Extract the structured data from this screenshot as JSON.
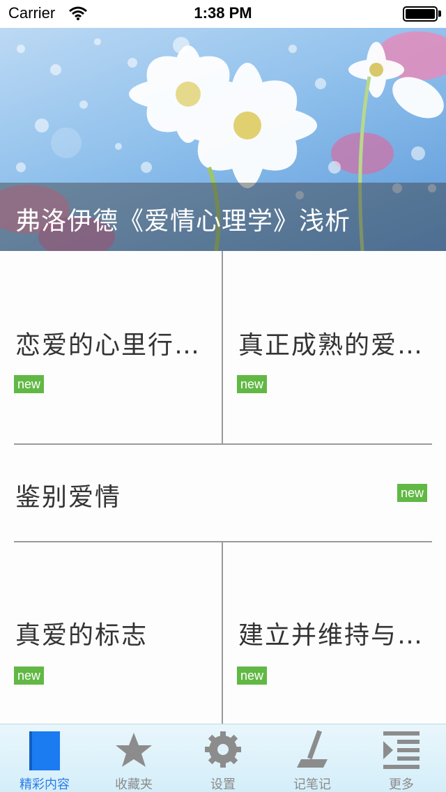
{
  "status_bar": {
    "carrier": "Carrier",
    "time": "1:38 PM"
  },
  "banner": {
    "title": "弗洛伊德《爱情心理学》浅析"
  },
  "articles": [
    {
      "title": "恋爱的心里行…",
      "badge": "new"
    },
    {
      "title": "真正成熟的爱…",
      "badge": "new"
    },
    {
      "title": "鉴别爱情",
      "badge": "new"
    },
    {
      "title": "真爱的标志",
      "badge": "new"
    },
    {
      "title": "建立并维持与…",
      "badge": "new"
    }
  ],
  "tabs": [
    {
      "label": "精彩内容",
      "icon": "book-icon",
      "active": true
    },
    {
      "label": "收藏夹",
      "icon": "star-icon",
      "active": false
    },
    {
      "label": "设置",
      "icon": "gear-icon",
      "active": false
    },
    {
      "label": "记笔记",
      "icon": "pen-icon",
      "active": false
    },
    {
      "label": "更多",
      "icon": "menu-icon",
      "active": false
    }
  ],
  "colors": {
    "badge": "#62b845",
    "active_tab": "#2a7ce8",
    "inactive_tab": "#8a8a8a",
    "divider": "#9a9a9a"
  }
}
